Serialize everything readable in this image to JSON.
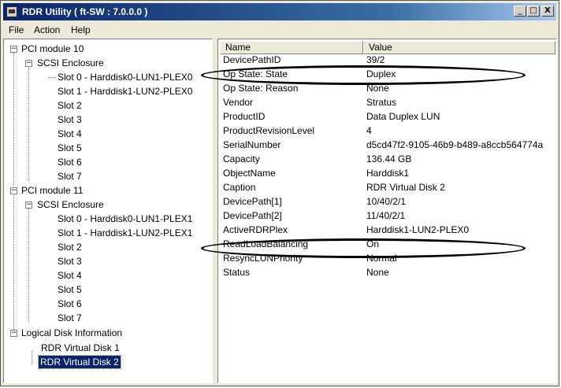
{
  "window": {
    "title": "RDR Utility ( ft-SW : 7.0.0.0 )",
    "minimize_glyph": "_",
    "maximize_glyph": "□",
    "close_glyph": "X"
  },
  "menu": {
    "file": "File",
    "action": "Action",
    "help": "Help"
  },
  "tree": {
    "pci10": "PCI module 10",
    "scsi10": "SCSI Enclosure",
    "pci10_slots": [
      "Slot 0  -  Harddisk0-LUN1-PLEX0",
      "Slot 1  -  Harddisk1-LUN2-PLEX0",
      "Slot 2",
      "Slot 3",
      "Slot 4",
      "Slot 5",
      "Slot 6",
      "Slot 7"
    ],
    "pci11": "PCI module 11",
    "scsi11": "SCSI Enclosure",
    "pci11_slots": [
      "Slot 0  -  Harddisk0-LUN1-PLEX1",
      "Slot 1  -  Harddisk1-LUN2-PLEX1",
      "Slot 2",
      "Slot 3",
      "Slot 4",
      "Slot 5",
      "Slot 6",
      "Slot 7"
    ],
    "logical": "Logical Disk Information",
    "virtual_disks": [
      "RDR Virtual Disk 1",
      "RDR Virtual Disk 2"
    ],
    "selected": "RDR Virtual Disk 2"
  },
  "list": {
    "headers": {
      "name": "Name",
      "value": "Value"
    },
    "rows": [
      {
        "name": "DevicePathID",
        "value": "39/2"
      },
      {
        "name": "Op State: State",
        "value": "Duplex"
      },
      {
        "name": "Op State: Reason",
        "value": "None"
      },
      {
        "name": "Vendor",
        "value": "Stratus"
      },
      {
        "name": "ProductID",
        "value": "Data Duplex LUN"
      },
      {
        "name": "ProductRevisionLevel",
        "value": "4"
      },
      {
        "name": "SerialNumber",
        "value": "d5cd47f2-9105-46b9-b489-a8ccb564774a"
      },
      {
        "name": "Capacity",
        "value": "136.44 GB"
      },
      {
        "name": "ObjectName",
        "value": "Harddisk1"
      },
      {
        "name": "Caption",
        "value": "RDR Virtual Disk 2"
      },
      {
        "name": "DevicePath[1]",
        "value": "10/40/2/1"
      },
      {
        "name": "DevicePath[2]",
        "value": "11/40/2/1"
      },
      {
        "name": "ActiveRDRPlex",
        "value": "Harddisk1-LUN2-PLEX0"
      },
      {
        "name": "ReadLoadBalancing",
        "value": "On"
      },
      {
        "name": "ResyncLUNPriority",
        "value": "Normal"
      },
      {
        "name": "Status",
        "value": "None"
      }
    ]
  }
}
